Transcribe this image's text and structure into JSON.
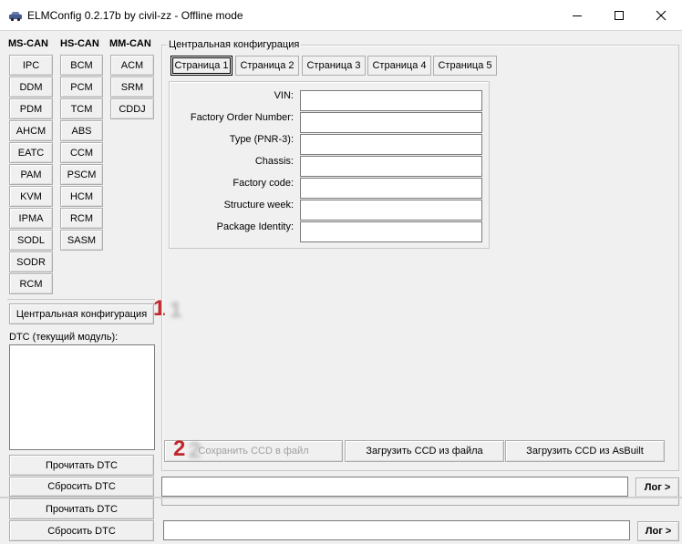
{
  "window": {
    "title": "ELMConfig 0.2.17b by civil-zz - Offline mode",
    "minimize_icon": "minimize-icon",
    "maximize_icon": "maximize-icon",
    "close_icon": "close-icon"
  },
  "modules": {
    "ms_can": {
      "header": "MS-CAN",
      "items": [
        "IPC",
        "DDM",
        "PDM",
        "AHCM",
        "EATC",
        "PAM",
        "KVM",
        "IPMA",
        "SODL",
        "SODR",
        "RCM"
      ]
    },
    "hs_can": {
      "header": "HS-CAN",
      "items": [
        "BCM",
        "PCM",
        "TCM",
        "ABS",
        "CCM",
        "PSCM",
        "HCM",
        "RCM",
        "SASM"
      ]
    },
    "mm_can": {
      "header": "MM-CAN",
      "items": [
        "ACM",
        "SRM",
        "CDDJ"
      ]
    }
  },
  "central_config_button": "Центральная конфигурация",
  "dtc": {
    "label": "DTC (текущий модуль):",
    "read_button": "Прочитать DTC",
    "reset_button": "Сбросить DTC"
  },
  "ccd_group": {
    "title": "Центральная конфигурация",
    "tabs": [
      "Страница 1",
      "Страница 2",
      "Страница 3",
      "Страница 4",
      "Страница 5"
    ],
    "active_tab": "Страница 1",
    "fields": [
      {
        "label": "VIN:",
        "value": ""
      },
      {
        "label": "Factory Order Number:",
        "value": ""
      },
      {
        "label": "Type (PNR-3):",
        "value": ""
      },
      {
        "label": "Chassis:",
        "value": ""
      },
      {
        "label": "Factory code:",
        "value": ""
      },
      {
        "label": "Structure week:",
        "value": ""
      },
      {
        "label": "Package Identity:",
        "value": ""
      }
    ],
    "save_button": "Сохранить CCD в файл",
    "load_file_button": "Загрузить CCD из файла",
    "load_asbuilt_button": "Загрузить CCD из AsBuilt"
  },
  "log": {
    "button": "Лог >",
    "value": ""
  },
  "bottom_duplicate": {
    "read_button": "Прочитать DTC",
    "reset_button": "Сбросить DTC",
    "log_button": "Лог >"
  },
  "markers": [
    "1",
    "2"
  ]
}
